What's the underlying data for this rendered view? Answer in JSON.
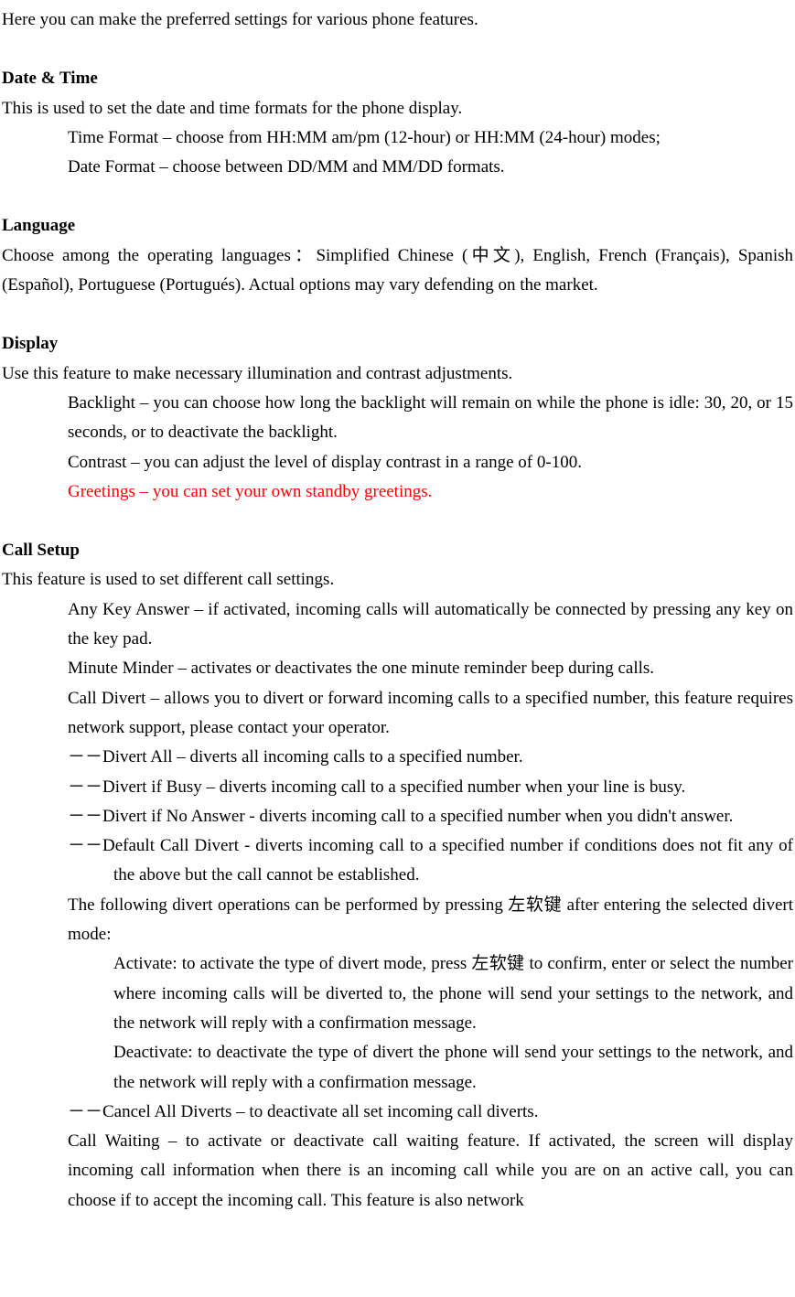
{
  "intro": "Here you can make the preferred settings for various phone features.",
  "dateTime": {
    "heading": "Date & Time",
    "desc": "This is used to set the date and time formats for the phone display.",
    "timeFormat": "Time Format – choose from HH:MM am/pm (12-hour) or HH:MM (24-hour) modes;",
    "dateFormat": "Date Format – choose between DD/MM and MM/DD formats."
  },
  "language": {
    "heading": "Language",
    "desc": "Choose among the operating languages：Simplified Chinese (中文), English, French (Français), Spanish (Español), Portuguese (Portugués). Actual options may vary defending on the market."
  },
  "display": {
    "heading": "Display",
    "desc": "Use this feature to make necessary illumination and contrast adjustments.",
    "backlight": "Backlight – you can choose how long the backlight will remain on while the phone is idle: 30, 20, or 15 seconds, or to deactivate the backlight.",
    "contrast": "Contrast – you can adjust the level of display contrast in a range of 0-100.",
    "greetings": "Greetings – you can set your own standby greetings."
  },
  "callSetup": {
    "heading": "Call Setup",
    "desc": "This feature is used to set different call settings.",
    "anyKey": "Any Key Answer – if activated, incoming calls will automatically be connected by pressing any key on the key pad.",
    "minuteMinder": "Minute Minder – activates or deactivates the one minute reminder beep during calls.",
    "callDivert": "Call Divert – allows you to divert or forward incoming calls to a specified number, this feature requires network support, please contact your operator.",
    "divertAll": "－－Divert All – diverts all incoming calls to a specified number.",
    "divertBusy": "－－Divert if Busy – diverts incoming call to a specified number when your line is busy.",
    "divertNoAnswer": "－－Divert if No Answer - diverts incoming call to a specified number when you didn't answer.",
    "defaultDivert": "－－Default Call Divert - diverts incoming call to a specified number if conditions does not fit any of the above but the call cannot be established.",
    "divertOps": "The following divert operations can be performed by pressing 左软键 after entering the selected divert mode:",
    "activate": "Activate: to activate the type of divert mode, press 左软键 to confirm, enter or select the number where incoming calls will be diverted to, the phone will send your settings to the network, and the network will reply with a confirmation message.",
    "deactivate": "Deactivate: to deactivate the type of divert the phone will send your settings to the network, and the network will reply with a confirmation message.",
    "cancelAll": "－－Cancel All Diverts – to deactivate all set incoming call diverts.",
    "callWaiting": "Call Waiting – to activate or deactivate call waiting feature. If activated, the screen will display incoming call information when there is an incoming call while you are on an active call, you can choose if to accept the incoming call. This feature is also network"
  }
}
